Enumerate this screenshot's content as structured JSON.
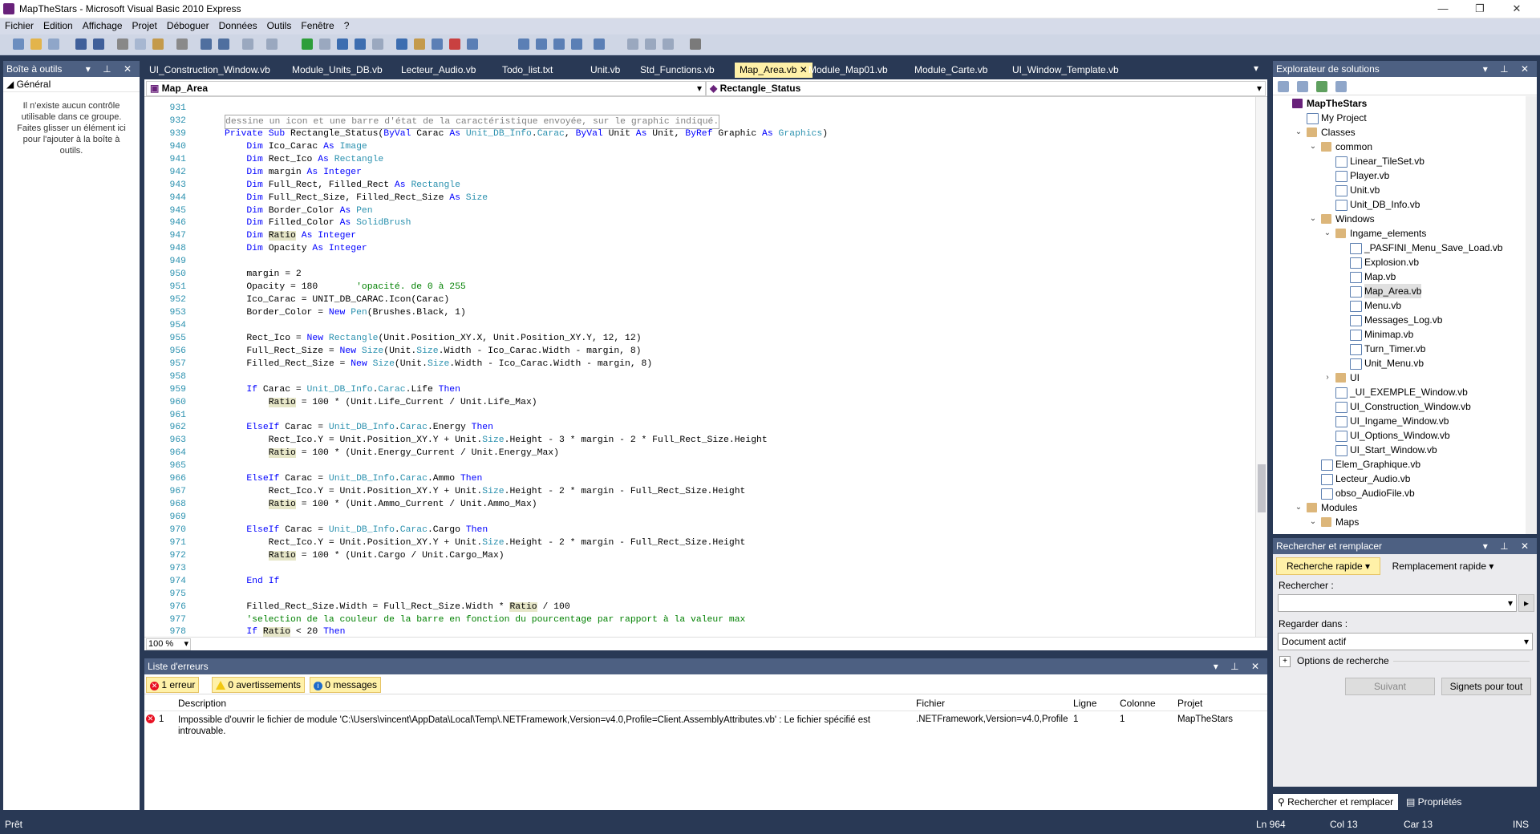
{
  "window": {
    "title": "MapTheStars - Microsoft Visual Basic 2010 Express",
    "minimize": "—",
    "maximize": "❐",
    "close": "✕"
  },
  "menu": [
    "Fichier",
    "Edition",
    "Affichage",
    "Projet",
    "Déboguer",
    "Données",
    "Outils",
    "Fenêtre",
    "?"
  ],
  "toolbox": {
    "title": "Boîte à outils",
    "group": "Général",
    "message": "Il n'existe aucun contrôle utilisable dans ce groupe. Faites glisser un élément ici pour l'ajouter à la boîte à outils."
  },
  "doc_tabs": [
    {
      "label": "UI_Construction_Window.vb"
    },
    {
      "label": "Module_Units_DB.vb"
    },
    {
      "label": "Lecteur_Audio.vb"
    },
    {
      "label": "Todo_list.txt"
    },
    {
      "label": "Unit.vb"
    },
    {
      "label": "Std_Functions.vb"
    },
    {
      "label": "Map_Area.vb",
      "active": true
    },
    {
      "label": "Module_Map01.vb"
    },
    {
      "label": "Module_Carte.vb"
    },
    {
      "label": "UI_Window_Template.vb"
    }
  ],
  "nav": {
    "class_combo": "Map_Area",
    "method_combo": "Rectangle_Status"
  },
  "editor": {
    "zoom": "100 %",
    "lines": [
      {
        "n": "931",
        "t": ""
      },
      {
        "n": "932",
        "t": "dessine un icon et une barre d'état de la caractéristique envoyée, sur le graphic indiqué.",
        "style": "boxed"
      },
      {
        "n": "939",
        "t": "Private Sub Rectangle_Status(ByVal Carac As Unit_DB_Info.Carac, ByVal Unit As Unit, ByRef Graphic As Graphics)"
      },
      {
        "n": "940",
        "t": "    Dim Ico_Carac As Image"
      },
      {
        "n": "941",
        "t": "    Dim Rect_Ico As Rectangle"
      },
      {
        "n": "942",
        "t": "    Dim margin As Integer"
      },
      {
        "n": "943",
        "t": "    Dim Full_Rect, Filled_Rect As Rectangle"
      },
      {
        "n": "944",
        "t": "    Dim Full_Rect_Size, Filled_Rect_Size As Size"
      },
      {
        "n": "945",
        "t": "    Dim Border_Color As Pen"
      },
      {
        "n": "946",
        "t": "    Dim Filled_Color As SolidBrush"
      },
      {
        "n": "947",
        "t": "    Dim Ratio As Integer"
      },
      {
        "n": "948",
        "t": "    Dim Opacity As Integer"
      },
      {
        "n": "949",
        "t": ""
      },
      {
        "n": "950",
        "t": "    margin = 2"
      },
      {
        "n": "951",
        "t": "    Opacity = 180       'opacité. de 0 à 255"
      },
      {
        "n": "952",
        "t": "    Ico_Carac = UNIT_DB_CARAC.Icon(Carac)"
      },
      {
        "n": "953",
        "t": "    Border_Color = New Pen(Brushes.Black, 1)"
      },
      {
        "n": "954",
        "t": ""
      },
      {
        "n": "955",
        "t": "    Rect_Ico = New Rectangle(Unit.Position_XY.X, Unit.Position_XY.Y, 12, 12)"
      },
      {
        "n": "956",
        "t": "    Full_Rect_Size = New Size(Unit.Size.Width - Ico_Carac.Width - margin, 8)"
      },
      {
        "n": "957",
        "t": "    Filled_Rect_Size = New Size(Unit.Size.Width - Ico_Carac.Width - margin, 8)"
      },
      {
        "n": "958",
        "t": ""
      },
      {
        "n": "959",
        "t": "    If Carac = Unit_DB_Info.Carac.Life Then"
      },
      {
        "n": "960",
        "t": "        Ratio = 100 * (Unit.Life_Current / Unit.Life_Max)"
      },
      {
        "n": "961",
        "t": ""
      },
      {
        "n": "962",
        "t": "    ElseIf Carac = Unit_DB_Info.Carac.Energy Then"
      },
      {
        "n": "963",
        "t": "        Rect_Ico.Y = Unit.Position_XY.Y + Unit.Size.Height - 3 * margin - 2 * Full_Rect_Size.Height"
      },
      {
        "n": "964",
        "t": "        Ratio = 100 * (Unit.Energy_Current / Unit.Energy_Max)"
      },
      {
        "n": "965",
        "t": ""
      },
      {
        "n": "966",
        "t": "    ElseIf Carac = Unit_DB_Info.Carac.Ammo Then"
      },
      {
        "n": "967",
        "t": "        Rect_Ico.Y = Unit.Position_XY.Y + Unit.Size.Height - 2 * margin - Full_Rect_Size.Height"
      },
      {
        "n": "968",
        "t": "        Ratio = 100 * (Unit.Ammo_Current / Unit.Ammo_Max)"
      },
      {
        "n": "969",
        "t": ""
      },
      {
        "n": "970",
        "t": "    ElseIf Carac = Unit_DB_Info.Carac.Cargo Then"
      },
      {
        "n": "971",
        "t": "        Rect_Ico.Y = Unit.Position_XY.Y + Unit.Size.Height - 2 * margin - Full_Rect_Size.Height"
      },
      {
        "n": "972",
        "t": "        Ratio = 100 * (Unit.Cargo / Unit.Cargo_Max)"
      },
      {
        "n": "973",
        "t": ""
      },
      {
        "n": "974",
        "t": "    End If"
      },
      {
        "n": "975",
        "t": ""
      },
      {
        "n": "976",
        "t": "    Filled_Rect_Size.Width = Full_Rect_Size.Width * Ratio / 100"
      },
      {
        "n": "977",
        "t": "    'selection de la couleur de la barre en fonction du pourcentage par rapport à la valeur max"
      },
      {
        "n": "978",
        "t": "    If Ratio < 20 Then"
      }
    ]
  },
  "error_list": {
    "title": "Liste d'erreurs",
    "errors_btn": "1 erreur",
    "warnings_btn": "0 avertissements",
    "messages_btn": "0 messages",
    "columns": {
      "description": "Description",
      "file": "Fichier",
      "line": "Ligne",
      "column": "Colonne",
      "project": "Projet"
    },
    "rows": [
      {
        "num": "1",
        "description": "Impossible d'ouvrir le fichier de module 'C:\\Users\\vincent\\AppData\\Local\\Temp\\.NETFramework,Version=v4.0,Profile=Client.AssemblyAttributes.vb' : Le fichier spécifié est introuvable.",
        "file": ".NETFramework,Version=v4.0,Profile",
        "line": "1",
        "column": "1",
        "project": "MapTheStars"
      }
    ]
  },
  "solution_explorer": {
    "title": "Explorateur de solutions",
    "items": [
      {
        "label": "MapTheStars",
        "depth": 0,
        "type": "proj",
        "arrow": ""
      },
      {
        "label": "My Project",
        "depth": 1,
        "type": "file",
        "arrow": ""
      },
      {
        "label": "Classes",
        "depth": 1,
        "type": "folder",
        "arrow": "v"
      },
      {
        "label": "common",
        "depth": 2,
        "type": "folder",
        "arrow": "v"
      },
      {
        "label": "Linear_TileSet.vb",
        "depth": 3,
        "type": "file",
        "arrow": ""
      },
      {
        "label": "Player.vb",
        "depth": 3,
        "type": "file",
        "arrow": ""
      },
      {
        "label": "Unit.vb",
        "depth": 3,
        "type": "file",
        "arrow": ""
      },
      {
        "label": "Unit_DB_Info.vb",
        "depth": 3,
        "type": "file",
        "arrow": ""
      },
      {
        "label": "Windows",
        "depth": 2,
        "type": "folder",
        "arrow": "v"
      },
      {
        "label": "Ingame_elements",
        "depth": 3,
        "type": "folder",
        "arrow": "v"
      },
      {
        "label": "_PASFINI_Menu_Save_Load.vb",
        "depth": 4,
        "type": "file",
        "arrow": ""
      },
      {
        "label": "Explosion.vb",
        "depth": 4,
        "type": "file",
        "arrow": ""
      },
      {
        "label": "Map.vb",
        "depth": 4,
        "type": "file",
        "arrow": ""
      },
      {
        "label": "Map_Area.vb",
        "depth": 4,
        "type": "file",
        "arrow": "",
        "selected": true
      },
      {
        "label": "Menu.vb",
        "depth": 4,
        "type": "file",
        "arrow": ""
      },
      {
        "label": "Messages_Log.vb",
        "depth": 4,
        "type": "file",
        "arrow": ""
      },
      {
        "label": "Minimap.vb",
        "depth": 4,
        "type": "file",
        "arrow": ""
      },
      {
        "label": "Turn_Timer.vb",
        "depth": 4,
        "type": "file",
        "arrow": ""
      },
      {
        "label": "Unit_Menu.vb",
        "depth": 4,
        "type": "file",
        "arrow": ""
      },
      {
        "label": "UI",
        "depth": 3,
        "type": "folder",
        "arrow": ">"
      },
      {
        "label": "_UI_EXEMPLE_Window.vb",
        "depth": 3,
        "type": "file",
        "arrow": ""
      },
      {
        "label": "UI_Construction_Window.vb",
        "depth": 3,
        "type": "file",
        "arrow": ""
      },
      {
        "label": "UI_Ingame_Window.vb",
        "depth": 3,
        "type": "file",
        "arrow": ""
      },
      {
        "label": "UI_Options_Window.vb",
        "depth": 3,
        "type": "file",
        "arrow": ""
      },
      {
        "label": "UI_Start_Window.vb",
        "depth": 3,
        "type": "file",
        "arrow": ""
      },
      {
        "label": "Elem_Graphique.vb",
        "depth": 2,
        "type": "file",
        "arrow": ""
      },
      {
        "label": "Lecteur_Audio.vb",
        "depth": 2,
        "type": "file",
        "arrow": ""
      },
      {
        "label": "obso_AudioFile.vb",
        "depth": 2,
        "type": "file",
        "arrow": ""
      },
      {
        "label": "Modules",
        "depth": 1,
        "type": "folder",
        "arrow": "v"
      },
      {
        "label": "Maps",
        "depth": 2,
        "type": "folder",
        "arrow": "v"
      }
    ]
  },
  "find_replace": {
    "title": "Rechercher et remplacer",
    "quick_find": "Recherche rapide",
    "quick_replace": "Remplacement rapide",
    "search_label": "Rechercher :",
    "search_value": "",
    "look_in_label": "Regarder dans :",
    "look_in_value": "Document actif",
    "options_label": "Options de recherche",
    "next_btn": "Suivant",
    "bookmark_btn": "Signets pour tout"
  },
  "bottom_tabs": {
    "find_tab": "Rechercher et remplacer",
    "props_tab": "Propriétés"
  },
  "status": {
    "ready": "Prêt",
    "line": "Ln 964",
    "col": "Col 13",
    "car": "Car 13",
    "mode": "INS"
  }
}
